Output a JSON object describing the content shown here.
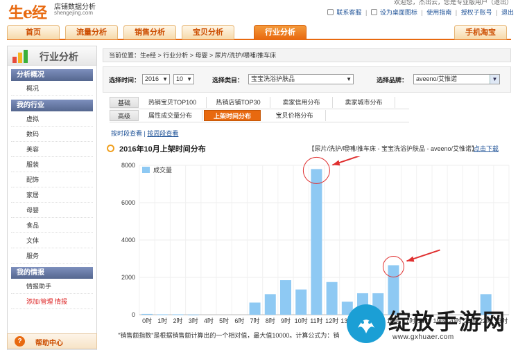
{
  "header": {
    "logo": "生e经",
    "logo_sub": "店铺数据分析",
    "logo_url": "shengejing.com",
    "welcome": "欢迎您，杰出云，您是专业版用户（退出）",
    "links": [
      "联系客服",
      "设为桌面图标",
      "使用指南",
      "授权子账号",
      "退出"
    ]
  },
  "nav": {
    "tabs": [
      "首页",
      "流量分析",
      "销售分析",
      "宝贝分析",
      "行业分析"
    ],
    "active_tab": "行业分析",
    "right_tab": "手机淘宝"
  },
  "sidebar": {
    "title": "行业分析",
    "sections": [
      {
        "title": "分析概况",
        "items": [
          "概况"
        ]
      },
      {
        "title": "我的行业",
        "items": [
          "虚拟",
          "数码",
          "美容",
          "服装",
          "配饰",
          "家居",
          "母婴",
          "食品",
          "文体",
          "服务"
        ]
      },
      {
        "title": "我的情报",
        "items": [
          "情报助手",
          "添加/管理 情报"
        ]
      }
    ],
    "help": "帮助中心"
  },
  "breadcrumb": "当前位置：生e经 > 行业分析 > 母婴 > 尿片/洗护/喂哺/推车床",
  "filters": {
    "time_label": "选择时间：",
    "year": "2016",
    "month": "10",
    "category_label": "选择类目：",
    "category": "宝宝洗浴护肤品",
    "brand_label": "选择品牌：",
    "brand": "aveeno/艾惟诺"
  },
  "subtabs": {
    "row1_label": "基础",
    "row1": [
      "热销宝贝TOP100",
      "热销店铺TOP30",
      "卖家信用分布",
      "卖家城市分布"
    ],
    "row2_label": "高级",
    "row2": [
      "属性成交量分布",
      "上架时间分布",
      "宝贝价格分布"
    ],
    "active": "上架时间分布"
  },
  "view_links": {
    "by_hour": "按时段查看",
    "sep": "|",
    "by_week": "按周段查看"
  },
  "chart_header": {
    "title": "2016年10月上架时间分布",
    "path": "【尿片/洗护/喂哺/推车床 - 宝宝洗浴护肤品 - aveeno/艾惟诺】",
    "download": "点击下载"
  },
  "footnote": "\"销售额指数\"是根据销售额计算出的一个相对值，最大值10000。计算公式为：销",
  "watermark": {
    "text": "绽放手游网",
    "url": "www.gxhuaer.com"
  },
  "colors": {
    "accent": "#e8690f",
    "bar": "#8ec9f3",
    "annotation": "#e03030"
  },
  "chart_data": {
    "type": "bar",
    "title": "",
    "legend": [
      "成交量"
    ],
    "legend_position": "top-left",
    "categories": [
      "0时",
      "1时",
      "2时",
      "3时",
      "4时",
      "5时",
      "6时",
      "7时",
      "8时",
      "9时",
      "10时",
      "11时",
      "12时",
      "13时",
      "14时",
      "15时",
      "16时",
      "17时",
      "18时",
      "19时",
      "20时",
      "21时",
      "22时",
      "23时"
    ],
    "values": [
      40,
      20,
      20,
      10,
      0,
      0,
      0,
      650,
      1100,
      1850,
      1350,
      7800,
      1750,
      700,
      1150,
      1150,
      2650,
      0,
      0,
      0,
      0,
      0,
      1100,
      0
    ],
    "ylim": [
      0,
      8000
    ],
    "yticks": [
      0,
      2000,
      4000,
      6000,
      8000
    ],
    "grid": true,
    "highlighted": [
      "11时",
      "16时"
    ]
  }
}
